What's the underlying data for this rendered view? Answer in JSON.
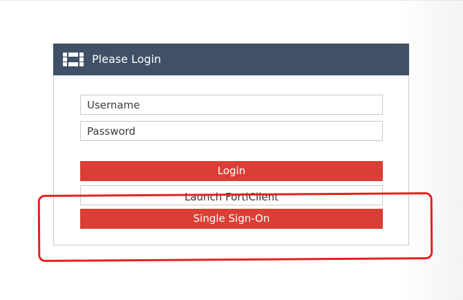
{
  "header": {
    "title": "Please Login",
    "logo_icon": "fortinet-logo-icon",
    "background_color": "#3f5067"
  },
  "form": {
    "username_placeholder": "Username",
    "password_placeholder": "Password",
    "login_label": "Login",
    "launch_forticlient_label": "Launch FortiClient",
    "sso_label": "Single Sign-On"
  },
  "colors": {
    "primary_button": "#d93f34",
    "annotation_outline": "#e3211d"
  }
}
